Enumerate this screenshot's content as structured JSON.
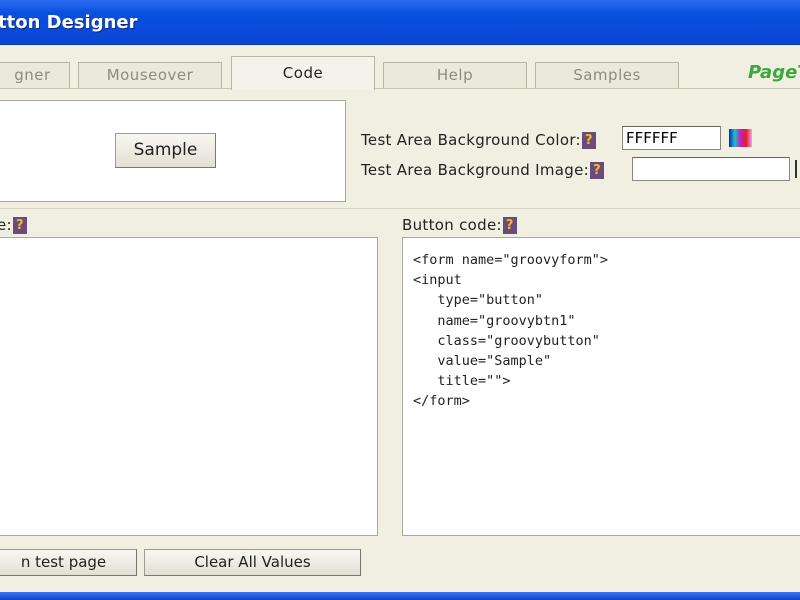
{
  "window": {
    "title": "tton Designer"
  },
  "tabs": [
    {
      "label": "gner"
    },
    {
      "label": "Mouseover"
    },
    {
      "label": "Code"
    },
    {
      "label": "Help"
    },
    {
      "label": "Samples"
    }
  ],
  "logo": "PageT",
  "test_area": {
    "sample_button": "Sample"
  },
  "settings": {
    "bg_color_label": "Test Area Background Color:",
    "bg_color_value": "FFFFFF",
    "bg_image_label": "Test Area Background Image:",
    "bg_image_value": "",
    "help": "?"
  },
  "left_panel": {
    "label": "e:"
  },
  "right_panel": {
    "label": "Button code:",
    "code": "<form name=\"groovyform\">\n<input\n   type=\"button\"\n   name=\"groovybtn1\"\n   class=\"groovybutton\"\n   value=\"Sample\"\n   title=\"\">\n</form>"
  },
  "buttons": {
    "test_page": "n test page",
    "clear": "Clear All Values"
  }
}
